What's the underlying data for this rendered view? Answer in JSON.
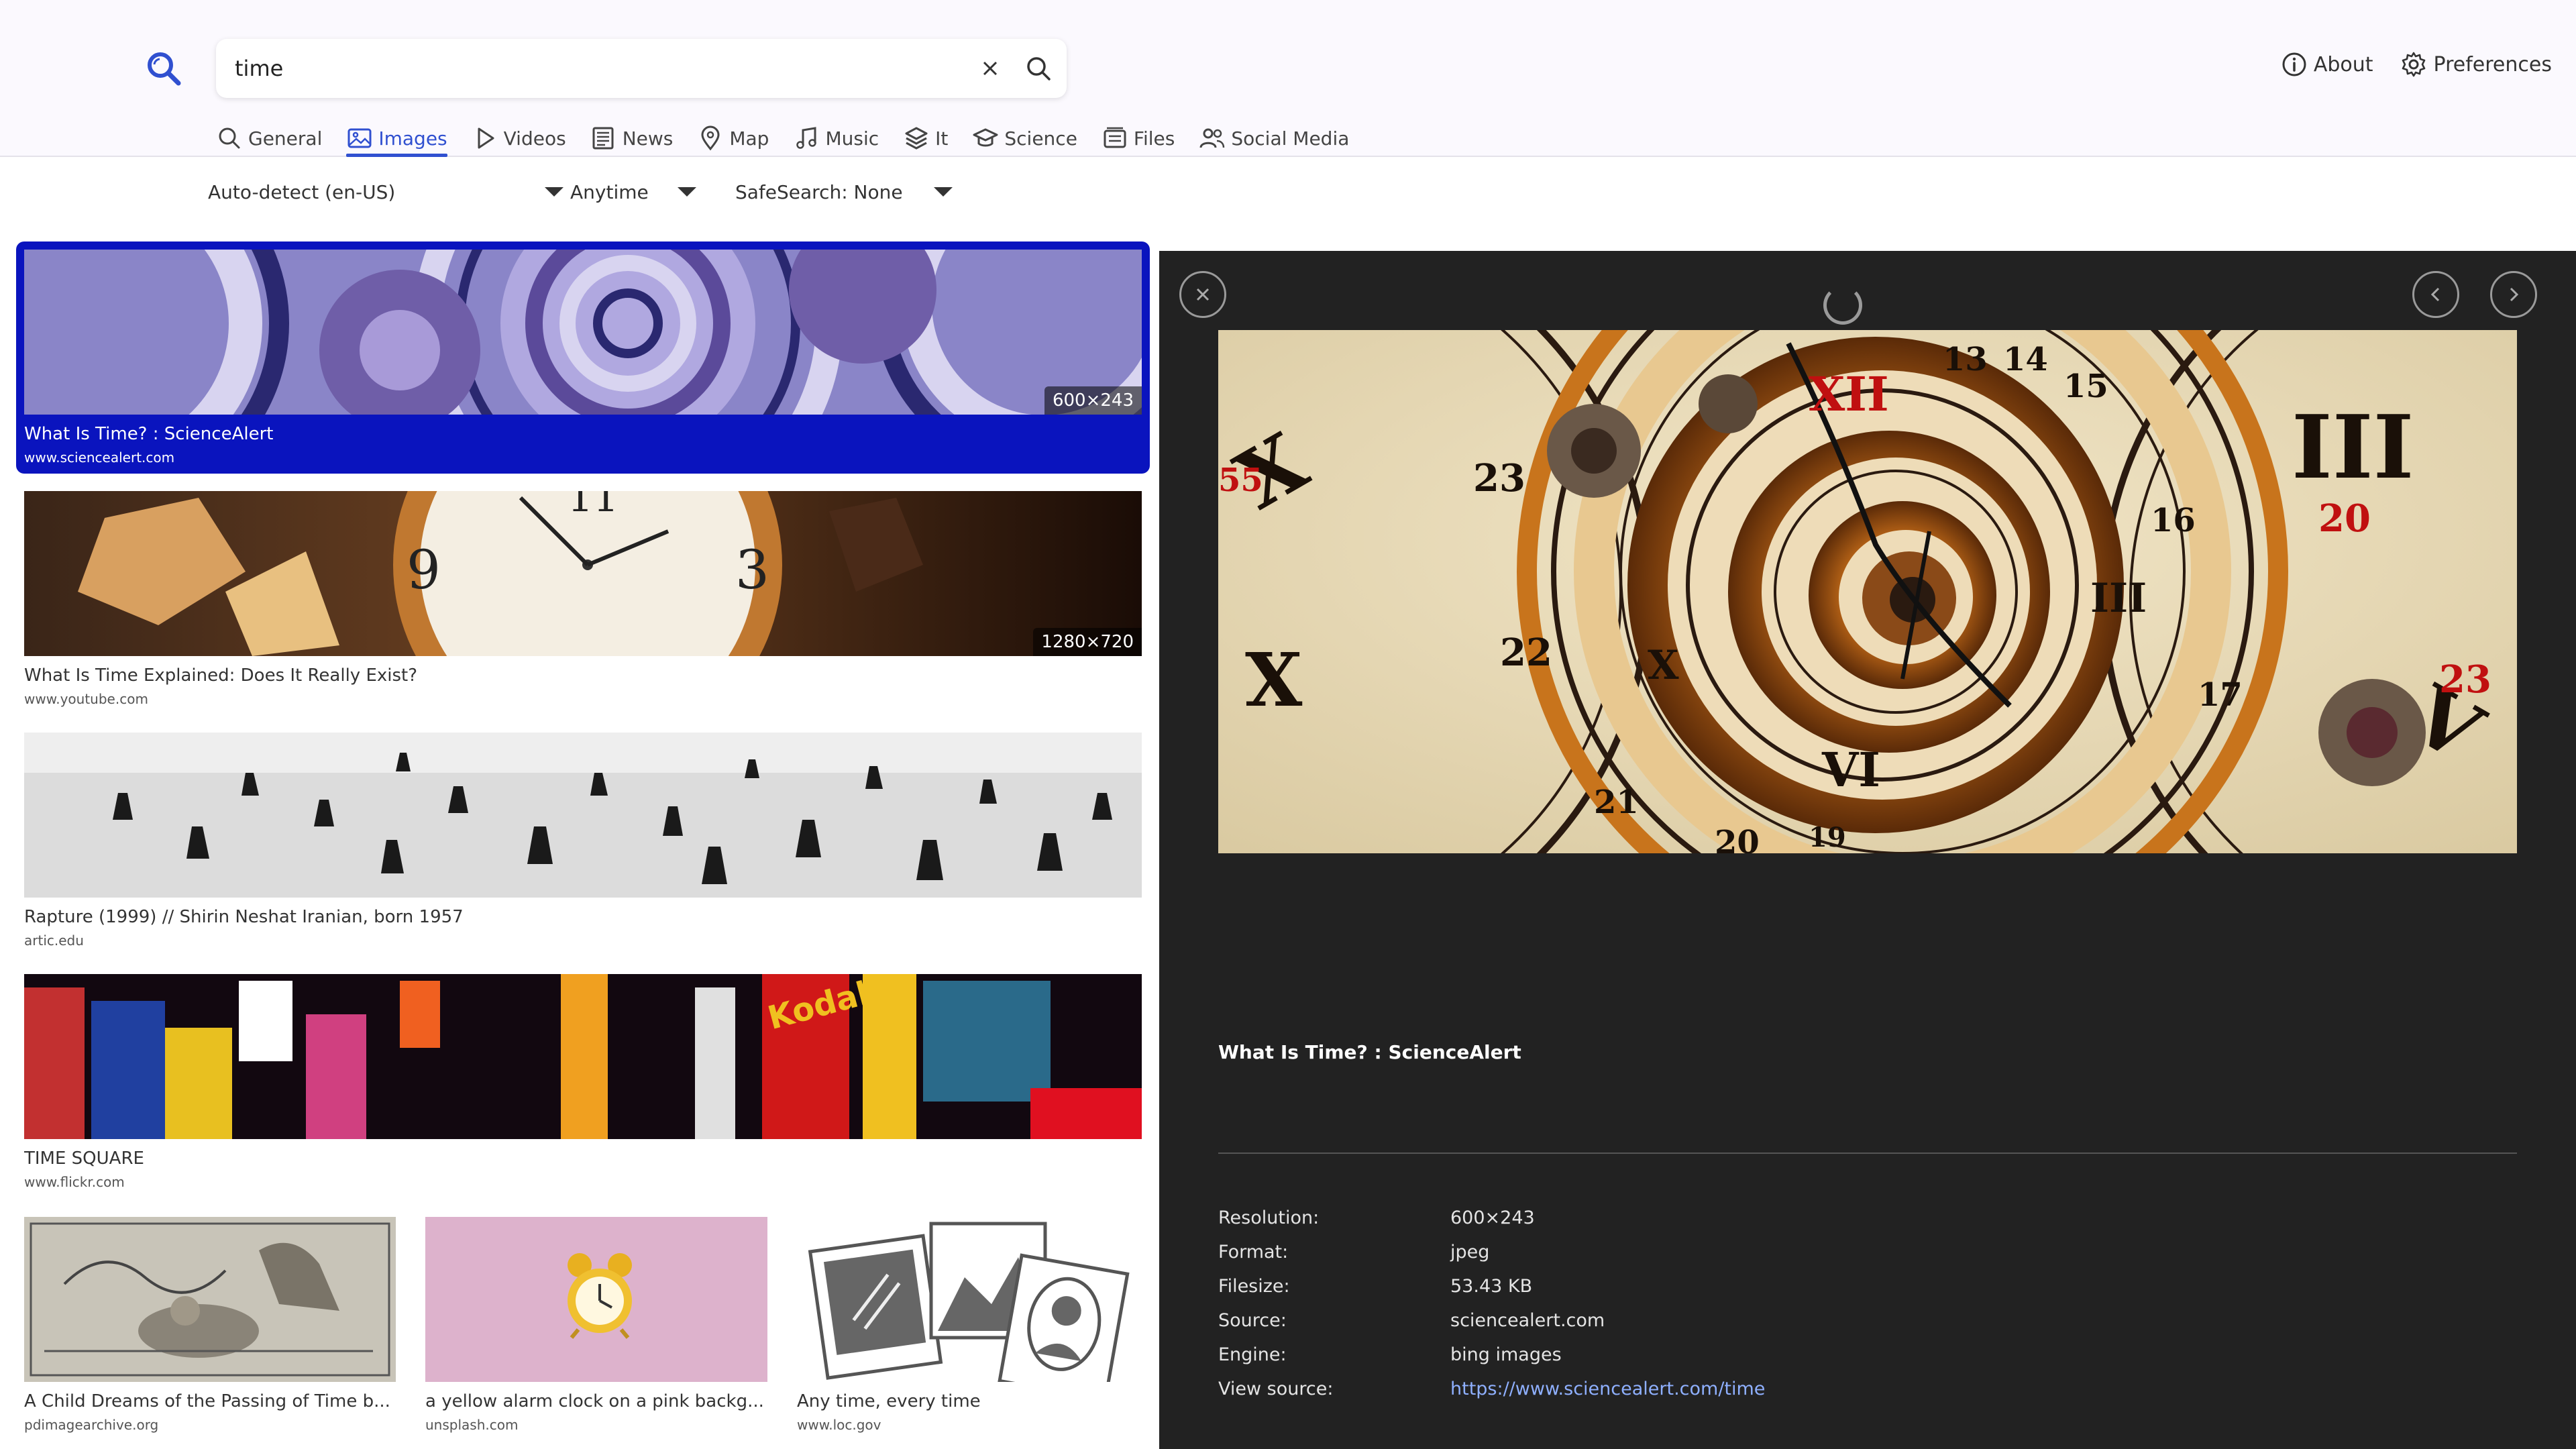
{
  "search": {
    "query": "time"
  },
  "top_links": {
    "about": "About",
    "preferences": "Preferences"
  },
  "tabs": [
    {
      "label": "General",
      "icon": "search-icon"
    },
    {
      "label": "Images",
      "icon": "image-icon",
      "active": true
    },
    {
      "label": "Videos",
      "icon": "play-icon"
    },
    {
      "label": "News",
      "icon": "newspaper-icon"
    },
    {
      "label": "Map",
      "icon": "map-pin-icon"
    },
    {
      "label": "Music",
      "icon": "music-icon"
    },
    {
      "label": "It",
      "icon": "layers-icon"
    },
    {
      "label": "Science",
      "icon": "graduation-cap-icon"
    },
    {
      "label": "Files",
      "icon": "files-icon"
    },
    {
      "label": "Social Media",
      "icon": "people-icon"
    }
  ],
  "filters": {
    "language": "Auto-detect (en-US)",
    "time": "Anytime",
    "safesearch": "SafeSearch: None"
  },
  "results": [
    {
      "title": "What Is Time? : ScienceAlert",
      "url": "www.sciencealert.com",
      "size": "600×243",
      "selected": true
    },
    {
      "title": "What Is Time Explained: Does It Really Exist?",
      "url": "www.youtube.com",
      "size": "1280×720"
    },
    {
      "title": "Rapture (1999) // Shirin Neshat Iranian, born 1957",
      "url": "artic.edu"
    },
    {
      "title": "TIME SQUARE",
      "url": "www.flickr.com"
    },
    {
      "title": "A Child Dreams of the Passing of Time b...",
      "url": "pdimagearchive.org"
    },
    {
      "title": "a yellow alarm clock on a pink backg...",
      "url": "unsplash.com"
    },
    {
      "title": "Any time, every time",
      "url": "www.loc.gov"
    }
  ],
  "detail": {
    "title": "What Is Time? : ScienceAlert",
    "meta": [
      {
        "key": "Resolution:",
        "value": "600×243"
      },
      {
        "key": "Format:",
        "value": "jpeg"
      },
      {
        "key": "Filesize:",
        "value": "53.43 KB"
      },
      {
        "key": "Source:",
        "value": "sciencealert.com"
      },
      {
        "key": "Engine:",
        "value": "bing images"
      },
      {
        "key": "View source:",
        "value": "https://www.sciencealert.com/time"
      }
    ]
  },
  "colors": {
    "accent": "#3050d0",
    "selected_bg": "#0a14be",
    "panel_bg": "#222222",
    "link": "#8fb0ff"
  }
}
